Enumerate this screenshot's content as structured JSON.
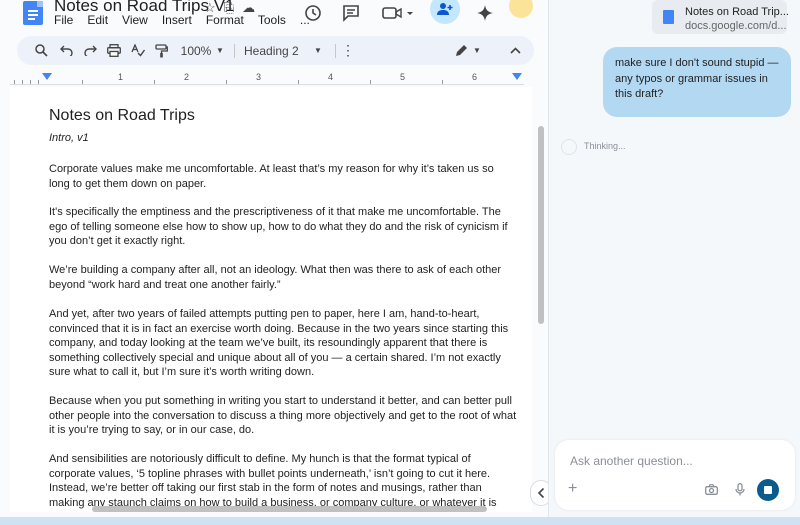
{
  "docs": {
    "title": "Notes on Road Trips V1",
    "title_icons": [
      "☆",
      "⎘",
      "☁"
    ],
    "menu": [
      "File",
      "Edit",
      "View",
      "Insert",
      "Format",
      "Tools",
      "..."
    ],
    "toolbar": {
      "zoom": "100%",
      "style": "Heading 2"
    },
    "ruler_numbers": [
      "1",
      "1",
      "2",
      "3",
      "4",
      "5",
      "6"
    ],
    "document": {
      "heading": "Notes on Road Trips",
      "subtitle": "Intro, v1",
      "paragraphs": [
        [
          "Corporate values make me uncomfortable. At least that’s my reason for why it’s taken us so",
          "long to get them down on paper."
        ],
        [
          "It's specifically the emptiness and the prescriptiveness of it that make me uncomfortable. The",
          "ego of telling someone else how to show up, how to do what they do and the risk of cynicism if",
          "you don’t get it exactly right."
        ],
        [
          "We’re building a company after all, not an ideology. What then was there to ask of each other",
          "beyond “work hard and treat one another fairly.”"
        ],
        [
          "And yet, after two years of failed attempts putting pen to paper, here I am, hand-to-heart,",
          "convinced that it is in fact an exercise worth doing. Because in the two years since starting this",
          "company, and today looking at the team we’ve built, its resoundingly apparent that there is",
          "something collectively special and unique about all of you — a certain shared. I’m not exactly",
          "sure what to call it, but I’m sure it’s worth writing down."
        ],
        [
          "Because when you put something in writing you start to understand it better, and can better pull",
          "other people into the conversation to discuss a thing more objectively and get to the root of what",
          "it is you’re trying to say, or in our case, do."
        ],
        [
          "And sensibilities are notoriously difficult to define. My hunch is that the format typical of",
          "corporate values, ‘5 topline phrases with bullet points underneath,’ isn’t going to cut it here.",
          "Instead, we’re better off taking our first stab in the form of notes and musings, rather than",
          "making any staunch claims on how to build a business, or company culture, or whatever it is"
        ]
      ]
    }
  },
  "chat": {
    "source": {
      "title": "Notes on Road Trip...",
      "url": "docs.google.com/d..."
    },
    "user_message": [
      "make sure I don't sound stupid —",
      "any typos or grammar issues in",
      "this draft?"
    ],
    "status": "Thinking...",
    "input_placeholder": "Ask another question..."
  },
  "colors": {
    "docs_blue": "#4285f4",
    "user_bubble": "#b3d8f2",
    "stop_button": "#0b5c8c",
    "share_button": "#c2e7ff"
  }
}
